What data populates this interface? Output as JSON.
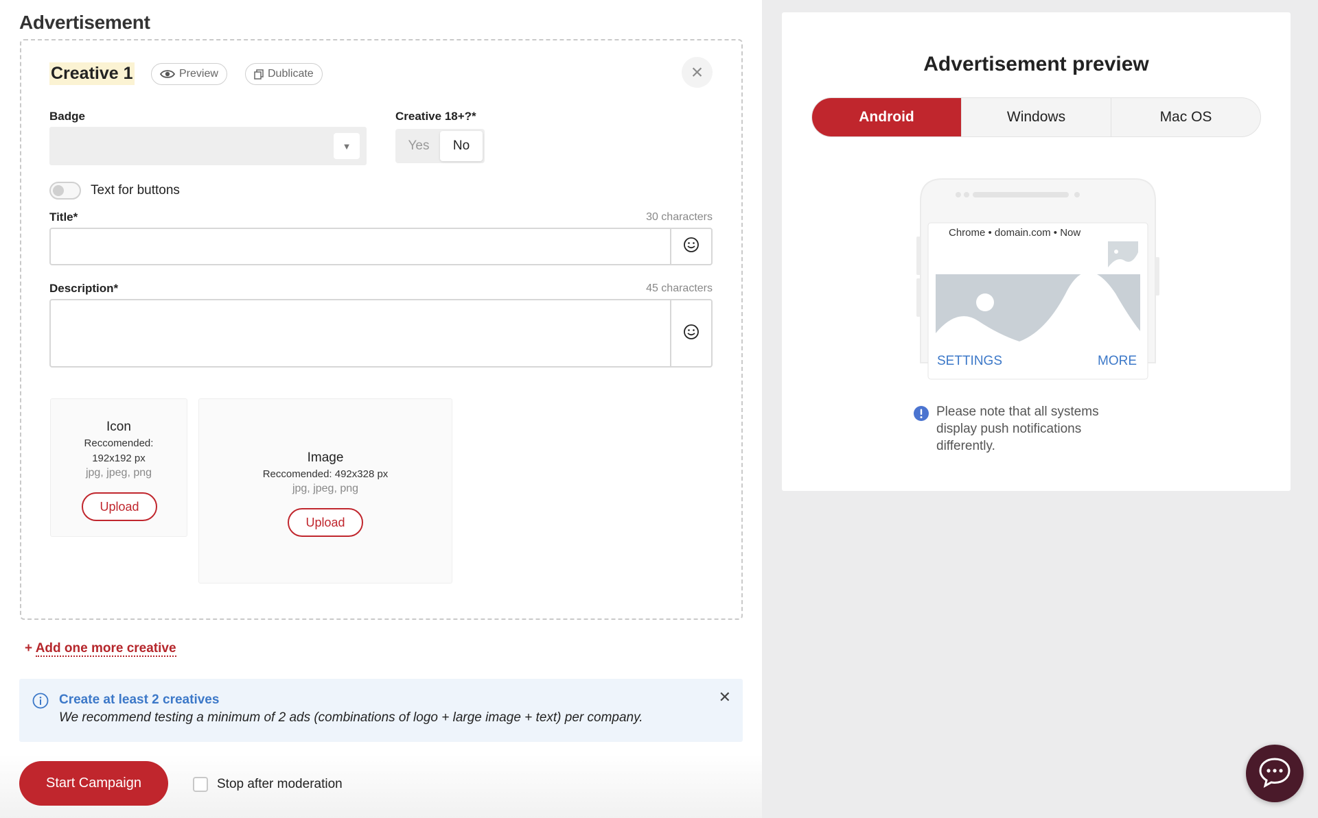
{
  "section": {
    "title": "Advertisement"
  },
  "creative": {
    "title": "Creative 1",
    "preview_label": "Preview",
    "duplicate_label": "Dublicate",
    "badge_label": "Badge",
    "badge_value": "",
    "adult_label": "Creative 18+?*",
    "adult_yes": "Yes",
    "adult_no": "No",
    "adult_selected": "No",
    "buttons_toggle_label": "Text for buttons",
    "buttons_toggle_on": false,
    "title_label": "Title*",
    "title_counter": "30 characters",
    "title_value": "",
    "description_label": "Description*",
    "description_counter": "45 characters",
    "description_value": "",
    "icon_upload": {
      "title": "Icon",
      "rec_line1": "Reccomended:",
      "rec_line2": "192x192 px",
      "formats": "jpg, jpeg, png",
      "button": "Upload"
    },
    "image_upload": {
      "title": "Image",
      "rec": "Reccomended: 492x328 px",
      "formats": "jpg, jpeg, png",
      "button": "Upload"
    }
  },
  "add_more": {
    "plus": "+",
    "label": "Add one more creative"
  },
  "info": {
    "title": "Create at least 2 creatives",
    "message": "We recommend testing a minimum of 2 ads (combinations of logo + large image + text) per company."
  },
  "footer": {
    "start_button": "Start Campaign",
    "stop_label": "Stop after moderation",
    "stop_checked": false
  },
  "preview": {
    "title": "Advertisement preview",
    "tabs": [
      "Android",
      "Windows",
      "Mac OS"
    ],
    "active_tab": "Android",
    "notification_header": "Chrome • domain.com • Now",
    "action_settings": "SETTINGS",
    "action_more": "MORE",
    "note": "Please note that all systems display push notifications differently."
  },
  "colors": {
    "accent": "#c0262d",
    "link_blue": "#3c78c8",
    "info_bg": "#eef4fb",
    "chat_bg": "#4a1a2a"
  },
  "icons": [
    "eye-icon",
    "copy-icon",
    "close-icon",
    "chevron-down-icon",
    "emoji-icon",
    "info-icon",
    "alert-icon",
    "chat-icon",
    "image-placeholder-icon"
  ]
}
